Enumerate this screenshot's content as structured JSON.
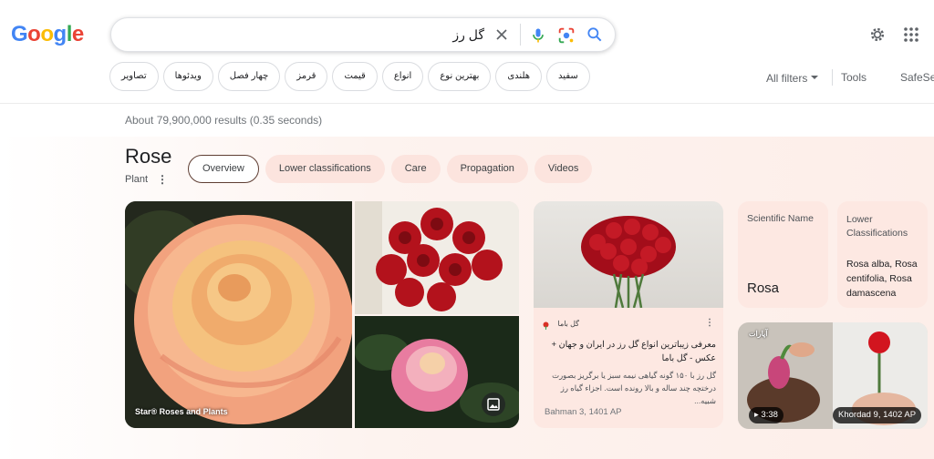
{
  "logo": {
    "letters": [
      "G",
      "o",
      "o",
      "g",
      "l",
      "e"
    ],
    "colors": [
      "#4285f4",
      "#ea4335",
      "#fbbc05",
      "#4285f4",
      "#34a853",
      "#ea4335"
    ]
  },
  "search": {
    "query": "گل رز"
  },
  "chips": [
    "سفید",
    "هلندی",
    "بهترین نوع",
    "انواع",
    "قیمت",
    "قرمز",
    "چهار فصل",
    "ویدئوها",
    "تصاویر"
  ],
  "toolbar": {
    "all_filters": "All filters",
    "tools": "Tools",
    "safesearch": "SafeSea"
  },
  "stats": "About 79,900,000 results (0.35 seconds)",
  "kp": {
    "title": "Rose",
    "subtitle": "Plant",
    "tabs": [
      "Overview",
      "Lower classifications",
      "Care",
      "Propagation",
      "Videos"
    ],
    "image_caption": "Star® Roses and Plants",
    "article": {
      "source": "گل باما",
      "title": "معرفی زیباترین انواع گل رز در ایران و جهان + عکس - گل باما",
      "desc": "گل رز با ۱۵۰ گونه گیاهی نیمه سبز یا برگریز بصورت درختچه چند ساله و بالا رونده است. اجزاء گیاه رز شبیه...",
      "date": "Bahman 3, 1401 AP"
    },
    "scientific": {
      "label": "Scientific Name",
      "value": "Rosa"
    },
    "lower": {
      "label": "Lower Classifications",
      "value": "Rosa alba, Rosa centifolia, Rosa damascena"
    },
    "video": {
      "source": "آپارات",
      "duration": "▸ 3:38",
      "date": "Khordad 9, 1402 AP"
    }
  },
  "colors": {
    "accent_blue": "#4285f4",
    "chip_pink": "#fce4de",
    "card_pink": "#fde8e2"
  }
}
